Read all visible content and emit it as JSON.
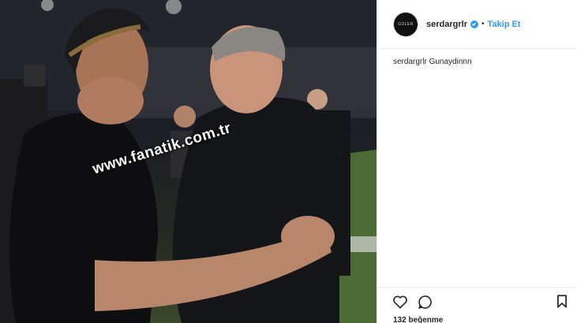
{
  "photo": {
    "watermark": "www.fanatik.com.tr"
  },
  "header": {
    "avatar_text": "GÜLER",
    "username": "serdargrlr",
    "separator": "•",
    "follow_label": "Takip Et"
  },
  "caption": {
    "username": "serdargrlr",
    "text": "Gunaydinnn"
  },
  "actions": {
    "like_icon": "heart-icon",
    "comment_icon": "comment-icon",
    "save_icon": "bookmark-icon",
    "likes_text": "132 beğenme"
  },
  "colors": {
    "link_blue": "#3897f0",
    "text": "#262626",
    "border": "#efefef"
  }
}
